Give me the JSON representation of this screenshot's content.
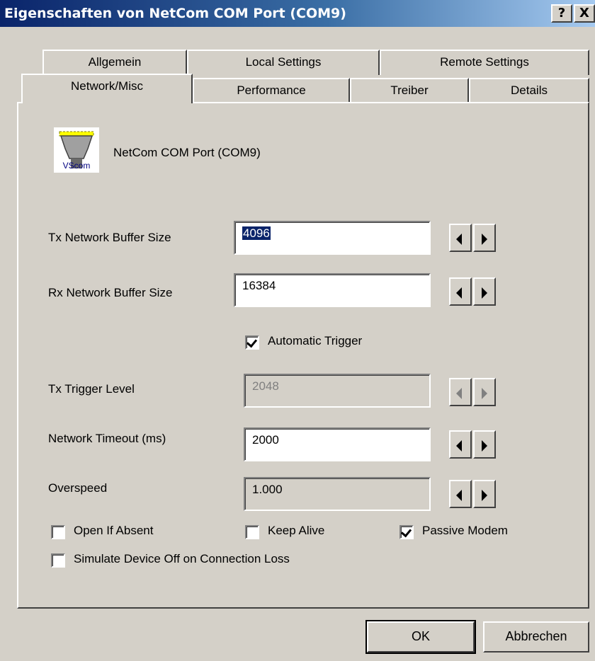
{
  "window": {
    "title": "Eigenschaften von NetCom COM Port (COM9)",
    "help_label": "?",
    "close_label": "X"
  },
  "tabs_row1": [
    "Allgemein",
    "Local Settings",
    "Remote Settings"
  ],
  "tabs_row2": [
    "Network/Misc",
    "Performance",
    "Treiber",
    "Details"
  ],
  "device": {
    "name": "NetCom COM Port (COM9)",
    "icon_text": "VScom"
  },
  "fields": {
    "tx_buffer": {
      "label": "Tx Network Buffer Size",
      "value": "4096"
    },
    "rx_buffer": {
      "label": "Rx Network Buffer Size",
      "value": "16384"
    },
    "tx_trigger": {
      "label": "Tx Trigger Level",
      "value": "2048"
    },
    "timeout": {
      "label": "Network Timeout (ms)",
      "value": "2000"
    },
    "overspeed": {
      "label": "Overspeed",
      "value": "1.000"
    }
  },
  "checkboxes": {
    "automatic_trigger": {
      "label": "Automatic Trigger",
      "checked": true
    },
    "open_if_absent": {
      "label": "Open If Absent",
      "checked": false
    },
    "keep_alive": {
      "label": "Keep Alive",
      "checked": false
    },
    "passive_modem": {
      "label": "Passive Modem",
      "checked": true
    },
    "simulate_off": {
      "label": "Simulate Device Off on Connection Loss",
      "checked": false
    }
  },
  "buttons": {
    "ok": "OK",
    "cancel": "Abbrechen"
  },
  "colors": {
    "face": "#d4d0c8",
    "title_start": "#0a246a",
    "title_end": "#a6caf0",
    "selection": "#0a246a"
  }
}
